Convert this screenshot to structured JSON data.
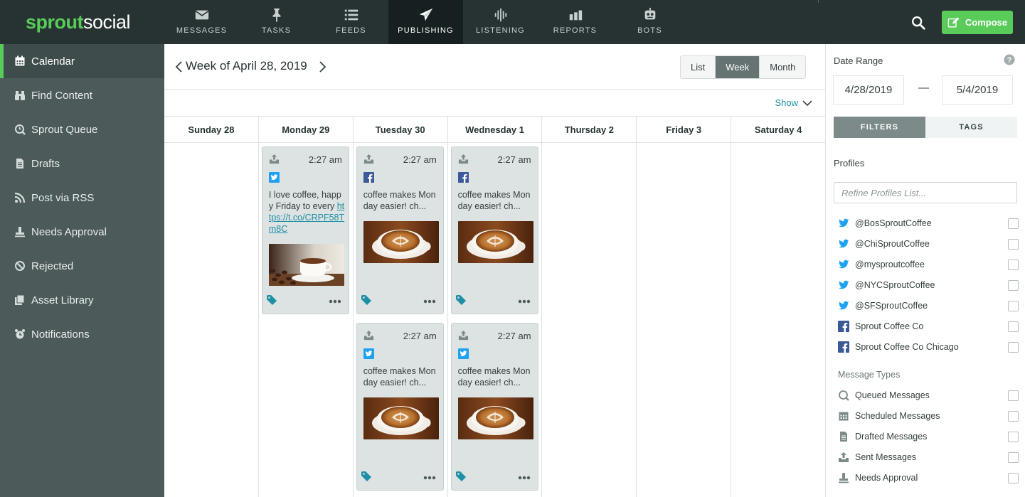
{
  "brand": {
    "sprout": "sprout",
    "social": "social",
    "accent": "#59cb59"
  },
  "nav": [
    {
      "label": "MESSAGES",
      "icon": "envelope-icon"
    },
    {
      "label": "TASKS",
      "icon": "pin-icon"
    },
    {
      "label": "FEEDS",
      "icon": "list-icon"
    },
    {
      "label": "PUBLISHING",
      "icon": "paper-plane-icon",
      "active": true
    },
    {
      "label": "LISTENING",
      "icon": "waveform-icon"
    },
    {
      "label": "REPORTS",
      "icon": "bar-chart-icon"
    },
    {
      "label": "BOTS",
      "icon": "robot-icon"
    }
  ],
  "compose": {
    "label": "Compose"
  },
  "sidebar": {
    "items": [
      {
        "label": "Calendar",
        "icon": "calendar-icon",
        "active": true
      },
      {
        "label": "Find Content",
        "icon": "binoculars-icon"
      },
      {
        "label": "Sprout Queue",
        "icon": "queue-icon"
      },
      {
        "label": "Drafts",
        "icon": "document-icon"
      },
      {
        "label": "Post via RSS",
        "icon": "rss-icon"
      },
      {
        "label": "Needs Approval",
        "icon": "stamp-icon"
      },
      {
        "label": "Rejected",
        "icon": "prohibited-icon"
      },
      {
        "label": "Asset Library",
        "icon": "library-icon"
      },
      {
        "label": "Notifications",
        "icon": "alarm-clock-icon"
      }
    ]
  },
  "calendar": {
    "week_title": "Week of April 28, 2019",
    "views": [
      "List",
      "Week",
      "Month"
    ],
    "active_view": "Week",
    "show_label": "Show",
    "days": [
      "Sunday 28",
      "Monday 29",
      "Tuesday 30",
      "Wednesday 1",
      "Thursday 2",
      "Friday 3",
      "Saturday 4"
    ],
    "posts": [
      {
        "day": 1,
        "slot": 0,
        "time": "2:27 am",
        "network": "twitter",
        "text": "I love coffee, happy Friday to every ",
        "link": "https://t.co/CRPF58Tm8C",
        "image": "coffee-cup-beans"
      },
      {
        "day": 2,
        "slot": 0,
        "time": "2:27 am",
        "network": "facebook",
        "text": "coffee makes Monday easier! ch...",
        "image": "latte-art"
      },
      {
        "day": 3,
        "slot": 0,
        "time": "2:27 am",
        "network": "facebook",
        "text": "coffee makes Monday easier! ch...",
        "image": "latte-art"
      },
      {
        "day": 2,
        "slot": 1,
        "time": "2:27 am",
        "network": "twitter",
        "text": "coffee makes Monday easier! ch...",
        "image": "latte-art"
      },
      {
        "day": 3,
        "slot": 1,
        "time": "2:27 am",
        "network": "twitter",
        "text": "coffee makes Monday easier! ch...",
        "image": "latte-art"
      }
    ]
  },
  "filters": {
    "date_range_label": "Date Range",
    "start_date": "4/28/2019",
    "end_date": "5/4/2019",
    "dash": "—",
    "tabs": [
      "FILTERS",
      "TAGS"
    ],
    "active_tab": "FILTERS",
    "profiles_label": "Profiles",
    "refine_placeholder": "Refine Profiles List...",
    "profiles": [
      {
        "name": "@BosSproutCoffee",
        "network": "twitter"
      },
      {
        "name": "@ChiSproutCoffee",
        "network": "twitter"
      },
      {
        "name": "@mysproutcoffee",
        "network": "twitter"
      },
      {
        "name": "@NYCSproutCoffee",
        "network": "twitter"
      },
      {
        "name": "@SFSproutCoffee",
        "network": "twitter"
      },
      {
        "name": "Sprout Coffee Co",
        "network": "facebook"
      },
      {
        "name": "Sprout Coffee Co Chicago",
        "network": "facebook"
      }
    ],
    "message_types_label": "Message Types",
    "message_types": [
      {
        "name": "Queued Messages",
        "icon": "queue-icon"
      },
      {
        "name": "Scheduled Messages",
        "icon": "calendar-icon"
      },
      {
        "name": "Drafted Messages",
        "icon": "document-icon"
      },
      {
        "name": "Sent Messages",
        "icon": "sent-tray-icon"
      },
      {
        "name": "Needs Approval",
        "icon": "stamp-icon"
      }
    ]
  }
}
